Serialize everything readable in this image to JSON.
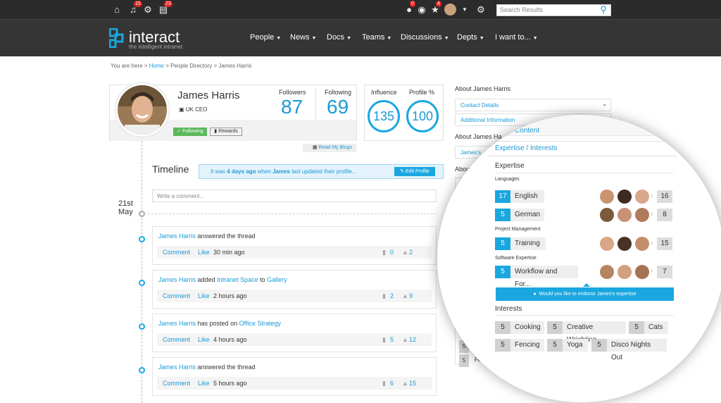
{
  "topbar": {
    "icons": [
      "home-icon",
      "bell-icon",
      "gear-icon",
      "tasks-icon"
    ],
    "bell_badge": "15",
    "tasks_badge": "23",
    "alert_badge": "0",
    "star_badge": "4",
    "search_placeholder": "Search Results"
  },
  "logo": {
    "name": "interact",
    "tagline": "the intelligent intranet"
  },
  "nav": [
    "People",
    "News",
    "Docs",
    "Teams",
    "Discussions",
    "Depts",
    "I want to..."
  ],
  "breadcrumb": {
    "prefix": "You are here >",
    "home": "Home",
    "rest": "> People Directory > James Harris"
  },
  "profile": {
    "name": "James Harris",
    "role": "UK CEO",
    "followers_label": "Followers",
    "followers": "87",
    "following_label": "Following",
    "following": "69",
    "following_btn": "Following",
    "rewards_btn": "Rewards",
    "blogs_link": "Read My Blogs"
  },
  "stats": {
    "influence_label": "Influence",
    "influence": "135",
    "profile_label": "Profile %",
    "profile": "100"
  },
  "timeline": {
    "title": "Timeline",
    "notice_pre": "It was",
    "notice_bold": "4 days ago",
    "notice_mid": "when",
    "notice_name": "James",
    "notice_post": "last updated their profile...",
    "edit_btn": "Edit Profile",
    "comment_placeholder": "Write a comment...",
    "date_day": "21st",
    "date_month": "May"
  },
  "posts": [
    {
      "actor": "James Harris",
      "text": "answered the thread",
      "link1": "",
      "mid": "",
      "link2": "",
      "time": "30 min ago",
      "comments": "0",
      "likes": "2"
    },
    {
      "actor": "James Harris",
      "text": "added",
      "link1": "Intranet Space",
      "mid": "to",
      "link2": "Gallery",
      "time": "2 hours ago",
      "comments": "2",
      "likes": "9"
    },
    {
      "actor": "James Harris",
      "text": "has posted on",
      "link1": "Office Strategy",
      "mid": "",
      "link2": "",
      "time": "4 hours ago",
      "comments": "5",
      "likes": "12"
    },
    {
      "actor": "James Harris",
      "text": "answered the thread",
      "link1": "",
      "mid": "",
      "link2": "",
      "time": "5 hours ago",
      "comments": "6",
      "likes": "15"
    }
  ],
  "post_actions": {
    "comment": "Comment",
    "like": "Like"
  },
  "sidebar": {
    "about": "About James Harris",
    "contact": "Contact Details",
    "additional": "Additional Information",
    "about2": "About James Ha",
    "james_s": "James's",
    "about3": "Abou",
    "partial_num1": "5",
    "partial_num2": "5",
    "partial_fe": "Fe"
  },
  "zoom": {
    "content_tab": "Content",
    "expertise_tab": "Expertise / Interests",
    "expertise_title": "Expertise",
    "groups": [
      {
        "name": "Languages",
        "items": [
          {
            "count": "17",
            "label": "English",
            "more": "16"
          },
          {
            "count": "5",
            "label": "German",
            "more": "8"
          }
        ]
      },
      {
        "name": "Project Management",
        "items": [
          {
            "count": "5",
            "label": "Training",
            "more": "15"
          }
        ]
      },
      {
        "name": "Software Expertise",
        "items": [
          {
            "count": "5",
            "label": "Workflow and For...",
            "more": "7"
          }
        ]
      }
    ],
    "endorse": "Would you like to endorse James's expertise",
    "interests_title": "Interests",
    "interests": [
      {
        "count": "5",
        "label": "Cooking"
      },
      {
        "count": "5",
        "label": "Creative Wrighting"
      },
      {
        "count": "5",
        "label": "Cats"
      },
      {
        "count": "5",
        "label": "Fencing"
      },
      {
        "count": "5",
        "label": "Yoga"
      },
      {
        "count": "5",
        "label": "Disco Nights Out"
      }
    ]
  },
  "colors": {
    "accent": "#1aa7e0",
    "dark": "#353535",
    "green": "#5cb85c"
  }
}
